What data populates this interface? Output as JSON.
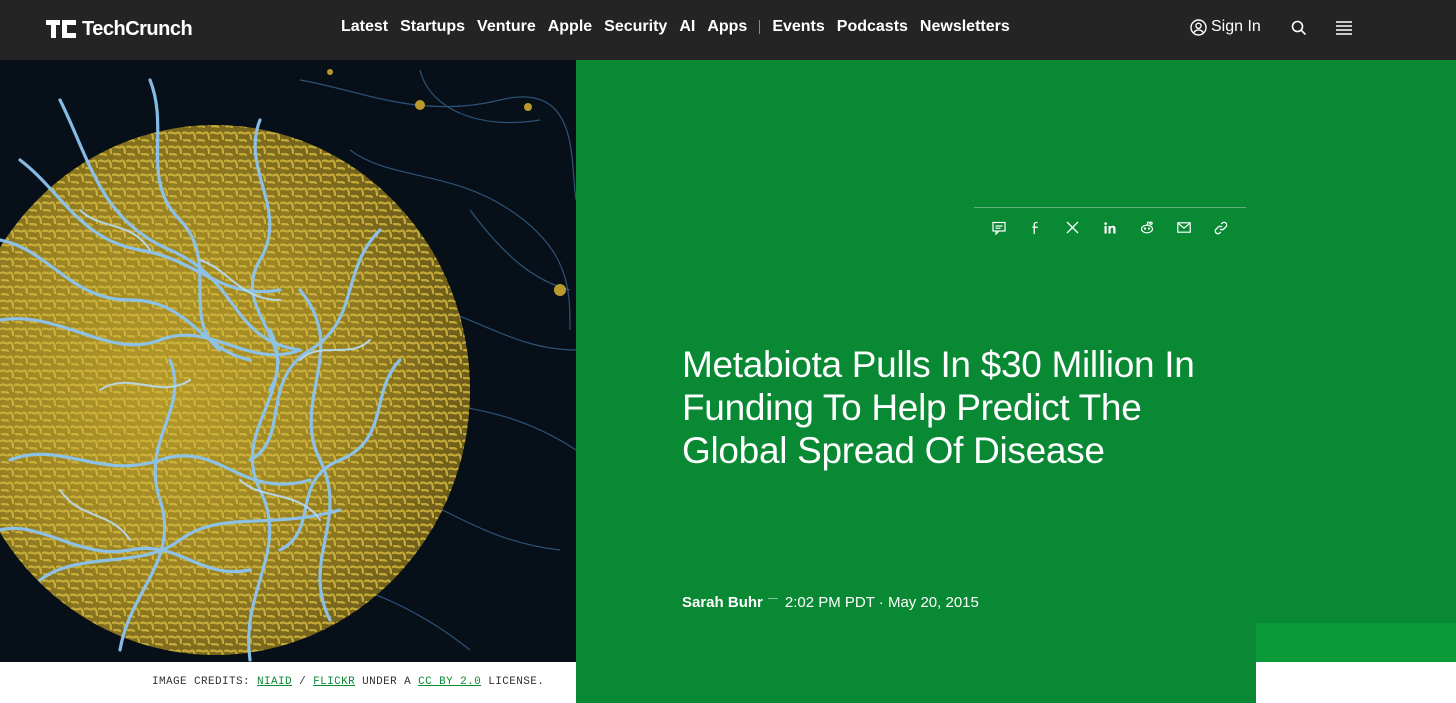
{
  "header": {
    "logo_text": "TechCrunch",
    "nav": [
      "Latest",
      "Startups",
      "Venture",
      "Apple",
      "Security",
      "AI",
      "Apps"
    ],
    "nav_secondary": [
      "Events",
      "Podcasts",
      "Newsletters"
    ],
    "sign_in": "Sign In",
    "icons": [
      "user-icon",
      "search-icon",
      "menu-icon"
    ]
  },
  "hero": {
    "image": "ebola-virus-micrograph",
    "credits": {
      "prefix": "IMAGE CREDITS:",
      "source1": "NIAID",
      "slash": "/",
      "source2": "FLICKR",
      "middle": "UNDER A",
      "license": "CC BY 2.0",
      "suffix": "LICENSE."
    }
  },
  "article": {
    "title": "Metabiota Pulls In $30 Million In Funding To Help Predict The Global Spread Of Disease",
    "author": "Sarah Buhr",
    "timestamp": "2:02 PM PDT · May 20, 2015",
    "share_icons": [
      "comment-icon",
      "facebook-icon",
      "x-icon",
      "linkedin-icon",
      "reddit-icon",
      "email-icon",
      "link-icon"
    ]
  },
  "colors": {
    "topbar": "#242424",
    "panel_green": "#0a8934",
    "accent_green": "#0b9a3a"
  }
}
